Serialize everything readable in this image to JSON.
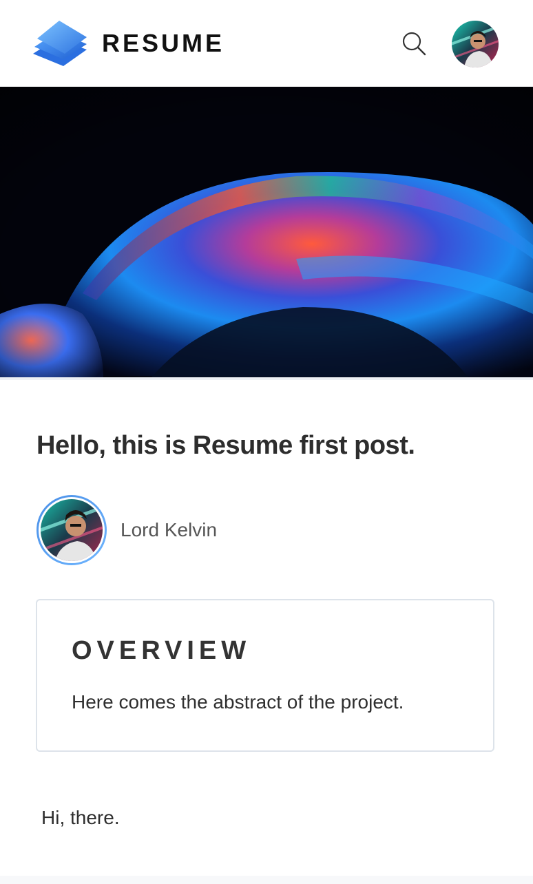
{
  "header": {
    "brand": "RESUME",
    "logo_icon": "stacked-layers-icon",
    "search_icon": "search-icon",
    "avatar_icon": "user-avatar"
  },
  "hero": {
    "image": "soap-bubble-hero-image"
  },
  "post": {
    "title": "Hello, this is Resume first post.",
    "author": {
      "name": "Lord Kelvin",
      "avatar": "author-avatar"
    },
    "overview": {
      "heading": "OVERVIEW",
      "text": "Here comes the abstract of the project."
    },
    "body": "Hi, there."
  },
  "colors": {
    "accent": "#4a8fe7",
    "logo_blue": "#3d86ec",
    "text": "#2d2d2d",
    "card_border": "#dde3ea"
  }
}
